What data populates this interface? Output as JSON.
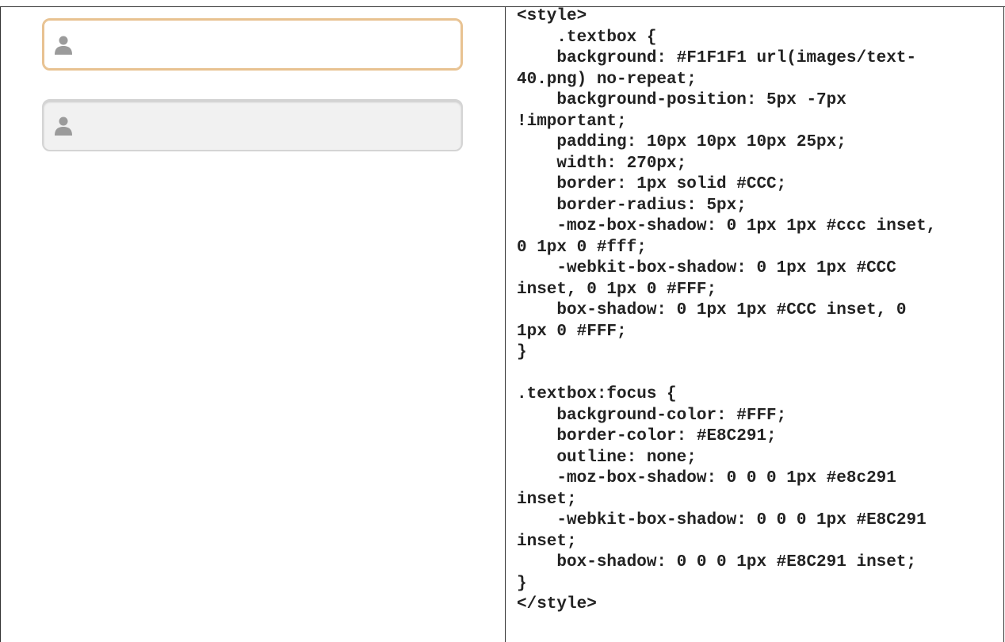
{
  "demo": {
    "focused_textbox": {
      "value": "",
      "placeholder": "",
      "icon": "user-icon",
      "border_color": "#E8C291",
      "background": "#FFFFFF"
    },
    "normal_textbox": {
      "value": "",
      "placeholder": "",
      "icon": "user-icon",
      "border_color": "#CCCCCC",
      "background": "#F1F1F1"
    }
  },
  "code": {
    "lines": [
      "<style>",
      "    .textbox {",
      "    background: #F1F1F1 url(images/text-",
      "40.png) no-repeat;",
      "    background-position: 5px -7px",
      "!important;",
      "    padding: 10px 10px 10px 25px;",
      "    width: 270px;",
      "    border: 1px solid #CCC;",
      "    border-radius: 5px;",
      "    -moz-box-shadow: 0 1px 1px #ccc inset,",
      "0 1px 0 #fff;",
      "    -webkit-box-shadow: 0 1px 1px #CCC",
      "inset, 0 1px 0 #FFF;",
      "    box-shadow: 0 1px 1px #CCC inset, 0",
      "1px 0 #FFF;",
      "}",
      "",
      ".textbox:focus {",
      "    background-color: #FFF;",
      "    border-color: #E8C291;",
      "    outline: none;",
      "    -moz-box-shadow: 0 0 0 1px #e8c291",
      "inset;",
      "    -webkit-box-shadow: 0 0 0 1px #E8C291",
      "inset;",
      "    box-shadow: 0 0 0 1px #E8C291 inset;",
      "}",
      "</style>"
    ]
  }
}
